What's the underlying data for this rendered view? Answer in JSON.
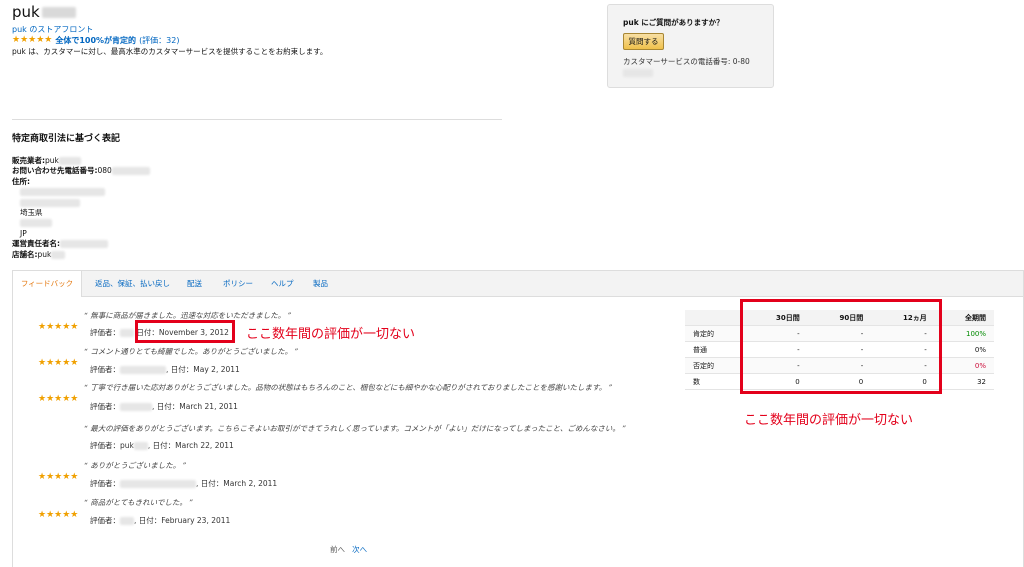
{
  "header": {
    "seller_name": "puk",
    "storefront": "puk のストアフロント",
    "rating_text": "全体で100%が肯定的",
    "rating_count": "(評価：32)",
    "tagline": "puk は、カスタマーに対し、最高水準のカスタマーサービスを提供することをお約束します。"
  },
  "question_box": {
    "title": "puk にご質問がありますか？",
    "button": "質問する",
    "phone": "カスタマーサービスの電話番号: 0-80"
  },
  "legal": {
    "title": "特定商取引法に基づく表記",
    "seller_label": "販売業者:",
    "seller_value": "puk",
    "phone_label": "お問い合わせ先電話番号:",
    "phone_value": "080",
    "address_label": "住所:",
    "prefecture": "埼玉県",
    "country": "JP",
    "manager_label": "運営責任者名:",
    "shop_label": "店舗名:",
    "shop_value": "puk"
  },
  "tabs": [
    "フィードバック",
    "返品、保証、払い戻し",
    "配送",
    "ポリシー",
    "ヘルプ",
    "製品"
  ],
  "feedback": [
    {
      "quote": "“ 無事に商品が届きました。迅速な対応をいただきました。 ”",
      "reviewer_label": "評価者：",
      "date": "日付：November 3, 2012",
      "stars": 5
    },
    {
      "quote": "“ コメント通りとても綺麗でした。ありがとうございました。 ”",
      "reviewer_label": "評価者：",
      "date": "日付：May 2, 2011",
      "stars": 5
    },
    {
      "quote": "“ 丁寧で行き届いた応対ありがとうございました。品物の状態はもちろんのこと、梱包などにも細やかな心配りがされておりましたことを感謝いたします。 ”",
      "reviewer_label": "評価者：",
      "date": "日付：March 21, 2011",
      "stars": 5
    },
    {
      "quote": "“ 最大の評価をありがとうございます。こちらこそよいお取引ができてうれしく思っています。コメントが「よい」だけになってしまったこと、ごめんなさい。 ”",
      "reviewer_label": "評価者：",
      "date": "日付：March 22, 2011",
      "stars": 0
    },
    {
      "quote": "“ ありがとうございました。 ”",
      "reviewer_label": "評価者：",
      "date": "日付：March 2, 2011",
      "stars": 5
    },
    {
      "quote": "“ 商品がとてもきれいでした。 ”",
      "reviewer_label": "評価者：",
      "date": "日付：February 23, 2011",
      "stars": 5
    }
  ],
  "stats": {
    "headers": [
      "",
      "30日間",
      "90日間",
      "12ヵ月",
      "全期間"
    ],
    "rows": [
      [
        "肯定的",
        "-",
        "-",
        "-",
        "100%"
      ],
      [
        "普通",
        "-",
        "-",
        "-",
        "0%"
      ],
      [
        "否定的",
        "-",
        "-",
        "-",
        "0%"
      ],
      [
        "数",
        "0",
        "0",
        "0",
        "32"
      ]
    ],
    "colors": {
      "positive": "#008a00",
      "negative": "#cc0c39"
    }
  },
  "annotations": {
    "note1": "ここ数年間の評価が一切ない",
    "note2": "ここ数年間の評価が一切ない",
    "color": "#e3001b"
  },
  "pager": {
    "prev": "前へ",
    "next": "次へ"
  }
}
